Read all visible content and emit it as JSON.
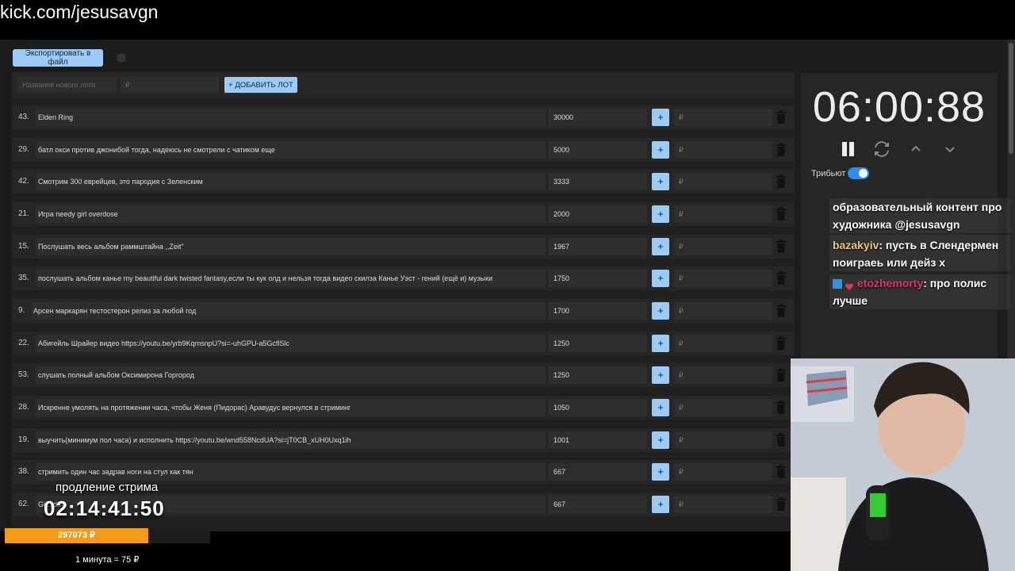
{
  "url": "kick.com/jesusavgn",
  "toolbar": {
    "export_label": "Экспортировать в файл"
  },
  "new_lot": {
    "name_placeholder": "Название нового лота",
    "amount_placeholder": "₽",
    "add_label": "+ ДОБАВИТЬ ЛОТ"
  },
  "currency": "₽",
  "plus": "+",
  "lots": [
    {
      "num": "43.",
      "name": "Elden Ring",
      "sum": "30000"
    },
    {
      "num": "29.",
      "name": "батл окси против джонибой тогда, надеюсь не смотрели с чатиком еще",
      "sum": "5000"
    },
    {
      "num": "42.",
      "name": "Смотрим 300 еврейцев, это пародия с Зеленским",
      "sum": "3333"
    },
    {
      "num": "21.",
      "name": "Игра needy girl overdose",
      "sum": "2000"
    },
    {
      "num": "15.",
      "name": "Послушать весь альбом раммштайна ,,Zeit\"",
      "sum": "1967"
    },
    {
      "num": "35.",
      "name": "послушать альбом канье my beautiful dark twisted fantasy,если ты кук олд и нельзя тогда видео скилза Канье Уэст - гений (ещё и) музыки",
      "sum": "1750"
    },
    {
      "num": "9.",
      "name": "Арсен маркарян тестостерон релиз за любой год",
      "sum": "1700"
    },
    {
      "num": "22.",
      "name": "Абигейль Шрайер видео https://youtu.be/yrb9KqmsnpU?si=-uhGPU-a5GcflSlc",
      "sum": "1250"
    },
    {
      "num": "53.",
      "name": "слушать полный альбом Оксимирона Горгород",
      "sum": "1250"
    },
    {
      "num": "28.",
      "name": "Искренне умолять на протяжении часа, чтобы Женя (Пидорас) Аравудус вернулся в стриминг",
      "sum": "1050"
    },
    {
      "num": "19.",
      "name": "выучить(минимум пол часа) и исполнить https://youtu.be/wnd558NcdUA?si=jT0CB_xUH0Uxq1ih",
      "sum": "1001"
    },
    {
      "num": "38.",
      "name": "стримить один час задрав ноги на стул как тян",
      "sum": "667"
    },
    {
      "num": "62.",
      "name": "Gi... day",
      "sum": "667"
    }
  ],
  "timer": {
    "display": "06:00:88"
  },
  "tribute": {
    "label": "Трибьют",
    "enabled": true
  },
  "chat": {
    "messages": [
      {
        "text": "образовательный контент про художника @jesusavgn"
      },
      {
        "user": "bazakyiv",
        "user_color": "#f3c37a",
        "text": ": пусть в Слендермен поиграеь или дейз х"
      },
      {
        "user": "etozhemorty",
        "user_color": "#e8335d",
        "text": ": про полис лучше"
      }
    ]
  },
  "overlay": {
    "extend_label": "продление стрима",
    "extend_timer": "02:14:41:50",
    "progress_label": "297073 ₽",
    "progress_fraction": 0.7,
    "rate_label": "1 минута = 75 ₽"
  },
  "colors": {
    "accent": "#9ecbf5",
    "progress": "#f59a1b",
    "toggle": "#2c8ff0"
  },
  "icons": [
    "trash-icon",
    "pause-icon",
    "reset-icon",
    "chevron-up-icon",
    "chevron-down-icon",
    "social-badge-icon",
    "heart-badge-icon"
  ]
}
